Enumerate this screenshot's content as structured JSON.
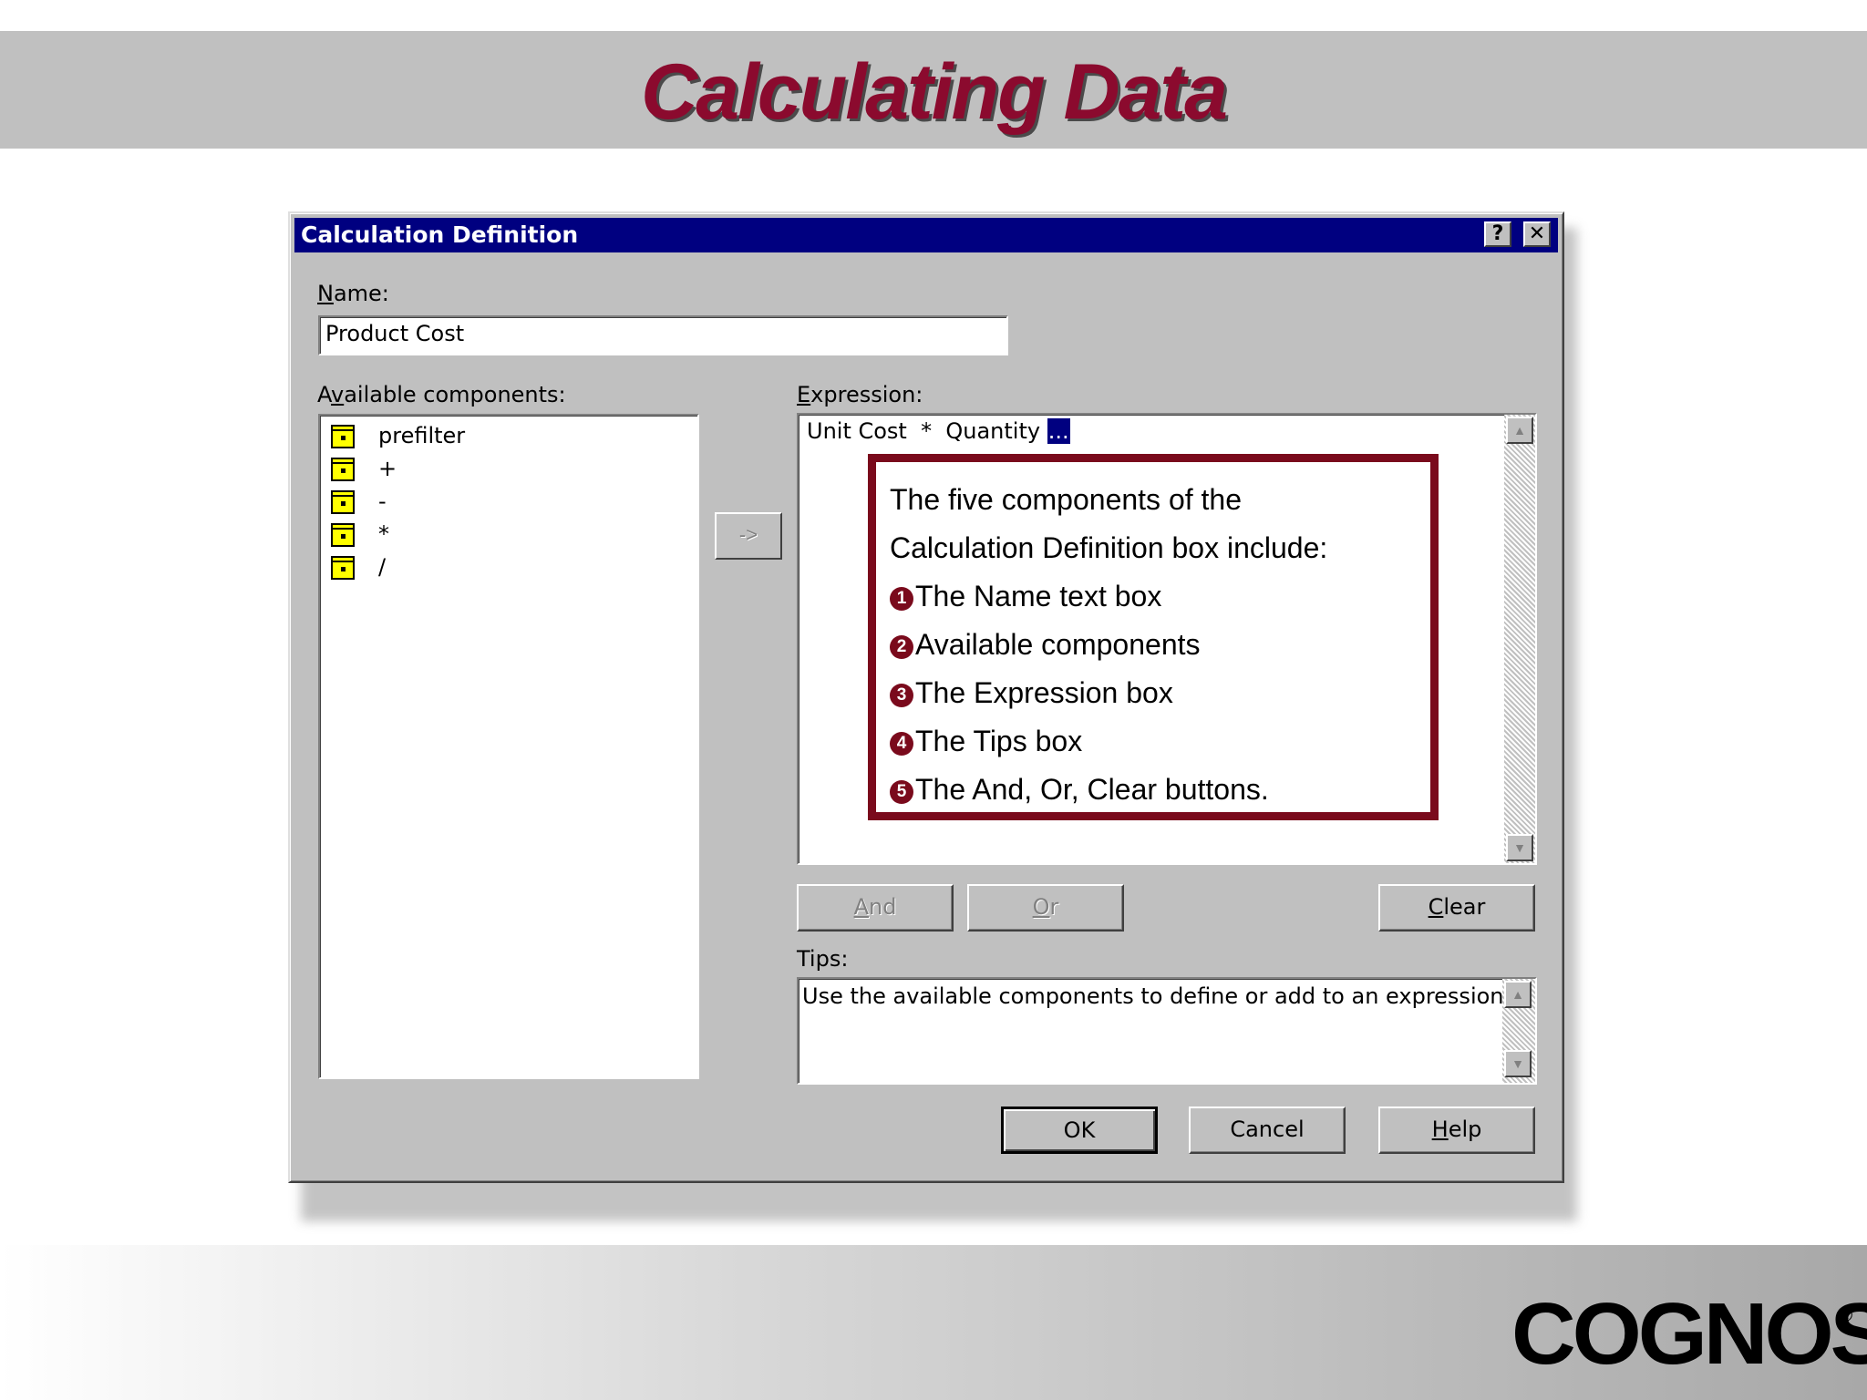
{
  "slide": {
    "title": "Calculating Data",
    "logo_text": "COGNOS",
    "logo_mark": "®"
  },
  "dialog": {
    "title": "Calculation Definition",
    "help_glyph": "?",
    "close_glyph": "✕",
    "name_label": "Name:",
    "name_value": "Product Cost",
    "available_label": "Available components:",
    "components": [
      {
        "label": "prefilter",
        "icon": "component-icon"
      },
      {
        "label": "+",
        "icon": "component-icon"
      },
      {
        "label": "-",
        "icon": "component-icon"
      },
      {
        "label": "*",
        "icon": "component-icon"
      },
      {
        "label": "/",
        "icon": "component-icon"
      }
    ],
    "insert_glyph": "->",
    "expression_label": "Expression:",
    "expression_text": "Unit Cost  *  Quantity ",
    "expression_cursor": "...",
    "and_label": "And",
    "or_label": "Or",
    "clear_label": "Clear",
    "tips_label": "Tips:",
    "tips_text": "Use the available components to define or add to an expression.",
    "ok_label": "OK",
    "cancel_label": "Cancel",
    "help_label": "Help",
    "scroll_up_glyph": "▲",
    "scroll_down_glyph": "▼"
  },
  "callout": {
    "intro_line1": "The five components of the",
    "intro_line2": "Calculation Definition box include:",
    "items": [
      {
        "num": "1",
        "text": "The Name text box"
      },
      {
        "num": "2",
        "text": "Available components"
      },
      {
        "num": "3",
        "text": "The Expression box"
      },
      {
        "num": "4",
        "text": "The Tips box"
      },
      {
        "num": "5",
        "text": "The And, Or, Clear buttons."
      }
    ],
    "accent_color": "#7a0a1c"
  },
  "colors": {
    "title_color": "#8b0a2e",
    "titlebar": "#000080",
    "dialog_face": "#c0c0c0"
  }
}
